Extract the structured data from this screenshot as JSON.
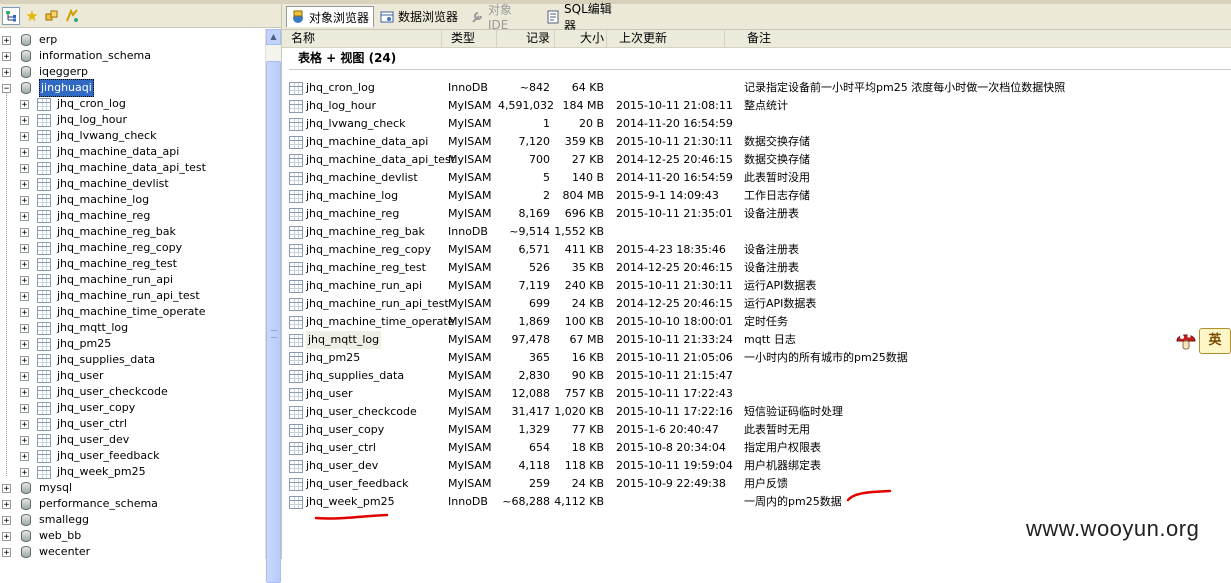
{
  "left_toolbar": {
    "icons": [
      "tree-view-icon",
      "star-icon",
      "connect-icon",
      "query-icon"
    ]
  },
  "tree": {
    "nodes": [
      {
        "label": "erp",
        "kind": "db",
        "expanded": false
      },
      {
        "label": "information_schema",
        "kind": "db-system",
        "expanded": false
      },
      {
        "label": "iqeggerp",
        "kind": "db",
        "expanded": false
      },
      {
        "label": "jinghuaqi",
        "kind": "db",
        "expanded": true,
        "selected": true
      },
      {
        "label": "jhq_cron_log",
        "kind": "table"
      },
      {
        "label": "jhq_log_hour",
        "kind": "table"
      },
      {
        "label": "jhq_lvwang_check",
        "kind": "table"
      },
      {
        "label": "jhq_machine_data_api",
        "kind": "table"
      },
      {
        "label": "jhq_machine_data_api_test",
        "kind": "table"
      },
      {
        "label": "jhq_machine_devlist",
        "kind": "table"
      },
      {
        "label": "jhq_machine_log",
        "kind": "table"
      },
      {
        "label": "jhq_machine_reg",
        "kind": "table"
      },
      {
        "label": "jhq_machine_reg_bak",
        "kind": "table"
      },
      {
        "label": "jhq_machine_reg_copy",
        "kind": "table"
      },
      {
        "label": "jhq_machine_reg_test",
        "kind": "table"
      },
      {
        "label": "jhq_machine_run_api",
        "kind": "table"
      },
      {
        "label": "jhq_machine_run_api_test",
        "kind": "table"
      },
      {
        "label": "jhq_machine_time_operate",
        "kind": "table"
      },
      {
        "label": "jhq_mqtt_log",
        "kind": "table"
      },
      {
        "label": "jhq_pm25",
        "kind": "table"
      },
      {
        "label": "jhq_supplies_data",
        "kind": "table"
      },
      {
        "label": "jhq_user",
        "kind": "table"
      },
      {
        "label": "jhq_user_checkcode",
        "kind": "table"
      },
      {
        "label": "jhq_user_copy",
        "kind": "table"
      },
      {
        "label": "jhq_user_ctrl",
        "kind": "table"
      },
      {
        "label": "jhq_user_dev",
        "kind": "table"
      },
      {
        "label": "jhq_user_feedback",
        "kind": "table"
      },
      {
        "label": "jhq_week_pm25",
        "kind": "table"
      },
      {
        "label": "mysql",
        "kind": "db",
        "expanded": false
      },
      {
        "label": "performance_schema",
        "kind": "db-system",
        "expanded": false
      },
      {
        "label": "smallegg",
        "kind": "db",
        "expanded": false
      },
      {
        "label": "web_bb",
        "kind": "db",
        "expanded": false
      },
      {
        "label": "wecenter",
        "kind": "db",
        "expanded": false
      }
    ]
  },
  "tabs": [
    {
      "label": "对象浏览器",
      "icon": "object-browser-icon",
      "active": true
    },
    {
      "label": "数据浏览器",
      "icon": "data-browser-icon",
      "active": false
    },
    {
      "label": "对象 IDE",
      "icon": "wrench-icon",
      "disabled": true
    },
    {
      "label": "SQL编辑器",
      "icon": "sql-editor-icon",
      "active": false
    }
  ],
  "columns": {
    "name": "名称",
    "type": "类型",
    "records": "记录",
    "size": "大小",
    "updated": "上次更新",
    "comment": "备注"
  },
  "group_title": "表格 + 视图 (24)",
  "rows": [
    {
      "name": "jhq_cron_log",
      "type": "InnoDB",
      "records": "~842",
      "size": "64 KB",
      "updated": "",
      "comment": "记录指定设备前一小时平均pm25 浓度每小时做一次档位数据快照"
    },
    {
      "name": "jhq_log_hour",
      "type": "MyISAM",
      "records": "4,591,032",
      "size": "184 MB",
      "updated": "2015-10-11 21:08:11",
      "comment": "整点统计"
    },
    {
      "name": "jhq_lvwang_check",
      "type": "MyISAM",
      "records": "1",
      "size": "20 B",
      "updated": "2014-11-20 16:54:59",
      "comment": ""
    },
    {
      "name": "jhq_machine_data_api",
      "type": "MyISAM",
      "records": "7,120",
      "size": "359 KB",
      "updated": "2015-10-11 21:30:11",
      "comment": "数据交换存储"
    },
    {
      "name": "jhq_machine_data_api_test",
      "type": "MyISAM",
      "records": "700",
      "size": "27 KB",
      "updated": "2014-12-25 20:46:15",
      "comment": "数据交换存储"
    },
    {
      "name": "jhq_machine_devlist",
      "type": "MyISAM",
      "records": "5",
      "size": "140 B",
      "updated": "2014-11-20 16:54:59",
      "comment": "此表暂时没用"
    },
    {
      "name": "jhq_machine_log",
      "type": "MyISAM",
      "records": "2",
      "size": "804 MB",
      "updated": "2015-9-1 14:09:43",
      "comment": "工作日志存储"
    },
    {
      "name": "jhq_machine_reg",
      "type": "MyISAM",
      "records": "8,169",
      "size": "696 KB",
      "updated": "2015-10-11 21:35:01",
      "comment": "设备注册表"
    },
    {
      "name": "jhq_machine_reg_bak",
      "type": "InnoDB",
      "records": "~9,514",
      "size": "1,552 KB",
      "updated": "",
      "comment": ""
    },
    {
      "name": "jhq_machine_reg_copy",
      "type": "MyISAM",
      "records": "6,571",
      "size": "411 KB",
      "updated": "2015-4-23 18:35:46",
      "comment": "设备注册表"
    },
    {
      "name": "jhq_machine_reg_test",
      "type": "MyISAM",
      "records": "526",
      "size": "35 KB",
      "updated": "2014-12-25 20:46:15",
      "comment": "设备注册表"
    },
    {
      "name": "jhq_machine_run_api",
      "type": "MyISAM",
      "records": "7,119",
      "size": "240 KB",
      "updated": "2015-10-11 21:30:11",
      "comment": "运行API数据表"
    },
    {
      "name": "jhq_machine_run_api_test",
      "type": "MyISAM",
      "records": "699",
      "size": "24 KB",
      "updated": "2014-12-25 20:46:15",
      "comment": "运行API数据表"
    },
    {
      "name": "jhq_machine_time_operate",
      "type": "MyISAM",
      "records": "1,869",
      "size": "100 KB",
      "updated": "2015-10-10 18:00:01",
      "comment": "定时任务"
    },
    {
      "name": "jhq_mqtt_log",
      "type": "MyISAM",
      "records": "97,478",
      "size": "67 MB",
      "updated": "2015-10-11 21:33:24",
      "comment": "mqtt 日志",
      "highlight": true
    },
    {
      "name": "jhq_pm25",
      "type": "MyISAM",
      "records": "365",
      "size": "16 KB",
      "updated": "2015-10-11 21:05:06",
      "comment": "一小时内的所有城市的pm25数据"
    },
    {
      "name": "jhq_supplies_data",
      "type": "MyISAM",
      "records": "2,830",
      "size": "90 KB",
      "updated": "2015-10-11 21:15:47",
      "comment": ""
    },
    {
      "name": "jhq_user",
      "type": "MyISAM",
      "records": "12,088",
      "size": "757 KB",
      "updated": "2015-10-11 17:22:43",
      "comment": ""
    },
    {
      "name": "jhq_user_checkcode",
      "type": "MyISAM",
      "records": "31,417",
      "size": "1,020 KB",
      "updated": "2015-10-11 17:22:16",
      "comment": "短信验证码临时处理"
    },
    {
      "name": "jhq_user_copy",
      "type": "MyISAM",
      "records": "1,329",
      "size": "77 KB",
      "updated": "2015-1-6 20:40:47",
      "comment": "此表暂时无用"
    },
    {
      "name": "jhq_user_ctrl",
      "type": "MyISAM",
      "records": "654",
      "size": "18 KB",
      "updated": "2015-10-8 20:34:04",
      "comment": "指定用户权限表"
    },
    {
      "name": "jhq_user_dev",
      "type": "MyISAM",
      "records": "4,118",
      "size": "118 KB",
      "updated": "2015-10-11 19:59:04",
      "comment": "用户机器绑定表"
    },
    {
      "name": "jhq_user_feedback",
      "type": "MyISAM",
      "records": "259",
      "size": "24 KB",
      "updated": "2015-10-9 22:49:38",
      "comment": "用户反馈"
    },
    {
      "name": "jhq_week_pm25",
      "type": "InnoDB",
      "records": "~68,288",
      "size": "4,112 KB",
      "updated": "",
      "comment": "一周内的pm25数据"
    }
  ],
  "ime_label": "英",
  "watermark": "www.wooyun.org",
  "annotation_color": "#e00000"
}
